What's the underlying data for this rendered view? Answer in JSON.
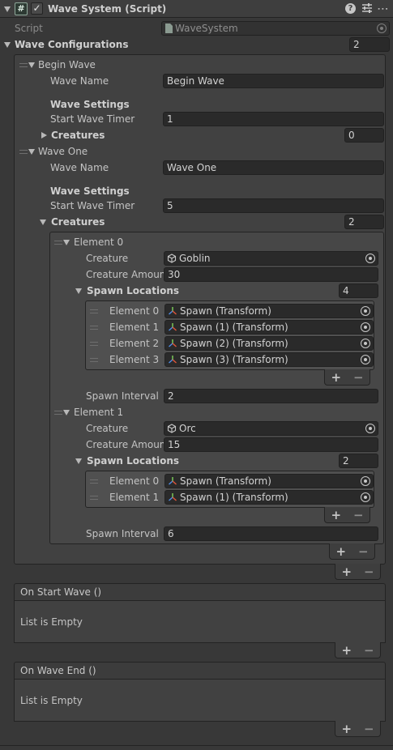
{
  "component": {
    "title": "Wave System (Script)",
    "script_label": "Script",
    "script_value": "WaveSystem"
  },
  "wave_configurations": {
    "label": "Wave Configurations",
    "count": "2",
    "items": [
      {
        "title": "Begin Wave",
        "wave_name_label": "Wave Name",
        "wave_name": "Begin Wave",
        "settings_label": "Wave Settings",
        "timer_label": "Start Wave Timer",
        "timer": "1",
        "creatures_label": "Creatures",
        "creatures_count": "0"
      },
      {
        "title": "Wave One",
        "wave_name_label": "Wave Name",
        "wave_name": "Wave One",
        "settings_label": "Wave Settings",
        "timer_label": "Start Wave Timer",
        "timer": "5",
        "creatures_label": "Creatures",
        "creatures_count": "2",
        "creatures": [
          {
            "title": "Element 0",
            "creature_label": "Creature",
            "creature": "Goblin",
            "amount_label": "Creature Amount",
            "amount": "30",
            "spawn_label": "Spawn Locations",
            "spawn_count": "4",
            "spawns": [
              {
                "label": "Element 0",
                "value": "Spawn (Transform)"
              },
              {
                "label": "Element 1",
                "value": "Spawn (1) (Transform)"
              },
              {
                "label": "Element 2",
                "value": "Spawn (2) (Transform)"
              },
              {
                "label": "Element 3",
                "value": "Spawn (3) (Transform)"
              }
            ],
            "interval_label": "Spawn Interval",
            "interval": "2"
          },
          {
            "title": "Element 1",
            "creature_label": "Creature",
            "creature": "Orc",
            "amount_label": "Creature Amount",
            "amount": "15",
            "spawn_label": "Spawn Locations",
            "spawn_count": "2",
            "spawns": [
              {
                "label": "Element 0",
                "value": "Spawn (Transform)"
              },
              {
                "label": "Element 1",
                "value": "Spawn (1) (Transform)"
              }
            ],
            "interval_label": "Spawn Interval",
            "interval": "6"
          }
        ]
      }
    ]
  },
  "events": [
    {
      "title": "On Start Wave ()",
      "empty": "List is Empty"
    },
    {
      "title": "On Wave End ()",
      "empty": "List is Empty"
    }
  ],
  "controls": {
    "plus": "+",
    "minus": "−"
  },
  "colors": {
    "background": "#383838",
    "field": "#2a2a2a",
    "border": "#232323",
    "text": "#c4c4c4"
  }
}
